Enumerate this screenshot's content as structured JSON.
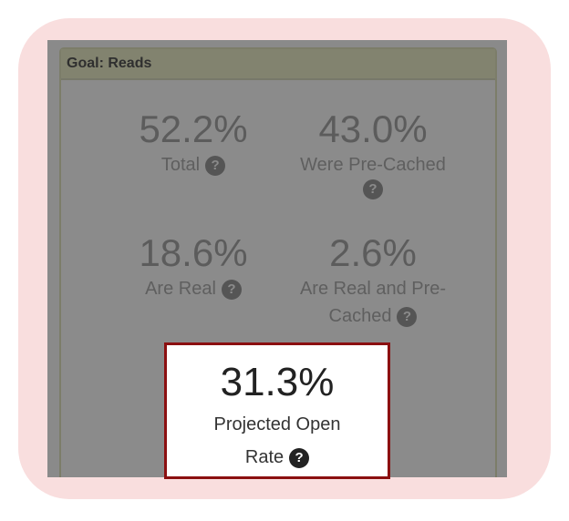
{
  "panel": {
    "title": "Goal: Reads"
  },
  "stats": {
    "total": {
      "value": "52.2%",
      "label": "Total"
    },
    "pre_cached": {
      "value": "43.0%",
      "label": "Were Pre-Cached"
    },
    "real": {
      "value": "18.6%",
      "label": "Are Real"
    },
    "real_pre_cached": {
      "value": "2.6%",
      "label_line1": "Are Real and Pre-",
      "label_line2": "Cached"
    }
  },
  "projected": {
    "value": "31.3%",
    "label_line1": "Projected Open",
    "label_line2": "Rate"
  },
  "icons": {
    "help_glyph": "?"
  },
  "colors": {
    "highlight_border": "#8b0f10",
    "frame_background": "#f9dede",
    "overlay_gray": "#8a8a8a"
  }
}
